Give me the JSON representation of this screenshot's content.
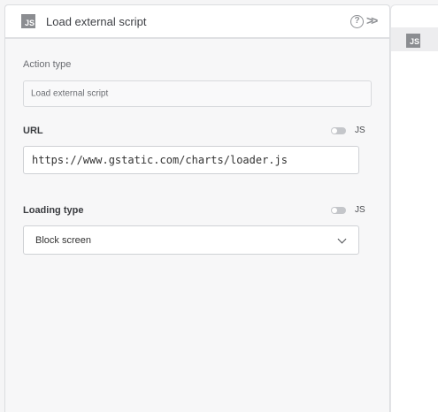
{
  "panel": {
    "badge": "JS",
    "title": "Load external script",
    "help_icon": "help-circle-icon",
    "expand_icon": "double-chevron-right-icon"
  },
  "action_type": {
    "label": "Action type",
    "value": "Load external script"
  },
  "url": {
    "label": "URL",
    "js_toggle_label": "JS",
    "js_toggle_on": false,
    "value": "https://www.gstatic.com/charts/loader.js"
  },
  "loading_type": {
    "label": "Loading type",
    "js_toggle_label": "JS",
    "js_toggle_on": false,
    "selected": "Block screen"
  },
  "canvas": {
    "badge": "JS"
  },
  "colors": {
    "badge_bg": "#8b8d91",
    "toggle_off": "#c4c6ca"
  }
}
